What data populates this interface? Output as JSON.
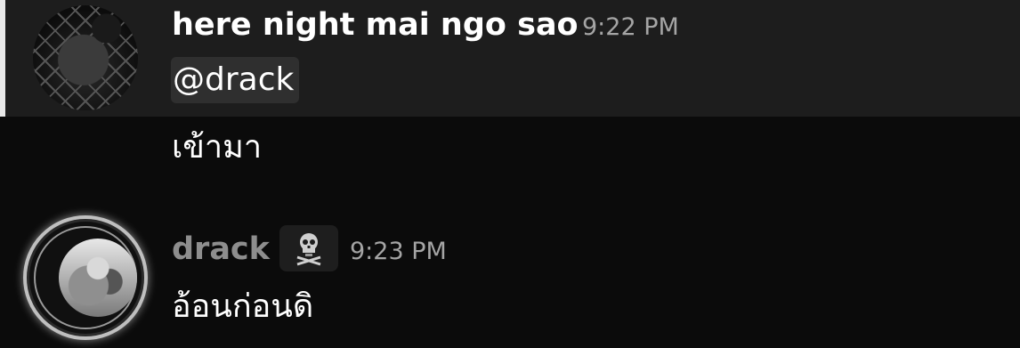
{
  "messages": [
    {
      "author": "here night mai ngo sao",
      "timestamp": "9:22 PM",
      "mention": "@drack",
      "lines": [
        "เข้ามา"
      ],
      "avatar_icon": "user-avatar"
    },
    {
      "author": "drack",
      "timestamp": "9:23 PM",
      "role_icon": "skull-icon",
      "lines": [
        "อ้อนก่อนดิ"
      ],
      "avatar_icon": "user-avatar-with-frame"
    }
  ],
  "colors": {
    "background": "#0b0b0b",
    "highlight_background": "#1d1d1d",
    "highlight_bar": "#e9e9e9",
    "mention_background": "#2f2f2f",
    "author_primary": "#ffffff",
    "author_secondary": "#8e8e8e",
    "timestamp": "#a5a5a5"
  }
}
